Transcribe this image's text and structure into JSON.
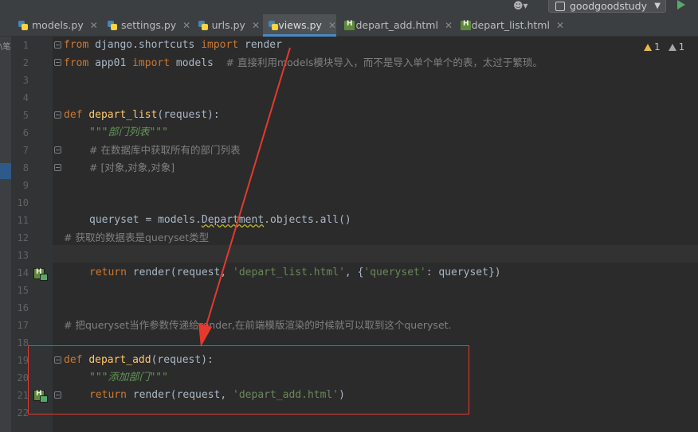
{
  "branch": "goodgoodstudy",
  "left_label": "\\笔",
  "tabs": [
    {
      "label": "models.py",
      "icon": "python-file-icon"
    },
    {
      "label": "settings.py",
      "icon": "python-file-icon"
    },
    {
      "label": "urls.py",
      "icon": "python-file-icon"
    },
    {
      "label": "views.py",
      "icon": "python-file-icon",
      "active": true
    },
    {
      "label": "depart_add.html",
      "icon": "html-file-icon"
    },
    {
      "label": "depart_list.html",
      "icon": "html-file-icon"
    }
  ],
  "inspections": {
    "warnings": "1",
    "weak_warnings": "1"
  },
  "line_numbers": [
    "1",
    "2",
    "3",
    "4",
    "5",
    "6",
    "7",
    "8",
    "9",
    "10",
    "11",
    "12",
    "13",
    "14",
    "15",
    "16",
    "17",
    "18",
    "19",
    "20",
    "21",
    "22"
  ],
  "code": {
    "l1": {
      "kw1": "from",
      "t1": " django.shortcuts ",
      "kw2": "import",
      "t2": " render"
    },
    "l2": {
      "kw1": "from",
      "t1": " app01 ",
      "kw2": "import",
      "t2": " models  ",
      "cm": "# 直接利用models模块导入，而不是导入单个单个的表，太过于繁琐。"
    },
    "l5": {
      "kw": "def",
      "fn": "depart_list",
      "t": "(request):"
    },
    "l6": {
      "doc": "\"\"\"部门列表\"\"\""
    },
    "l7": {
      "cm": "# 在数据库中获取所有的部门列表"
    },
    "l8": {
      "cm": "# [对象,对象,对象]"
    },
    "l11": {
      "t1": "queryset = models.",
      "u": "Department",
      "t2": ".objects.all()"
    },
    "l12": {
      "cm": "# 获取的数据表是queryset类型"
    },
    "l14": {
      "kw": "return",
      "t1": " render(request, ",
      "s1": "'depart_list.html'",
      "t2": ", {",
      "s2": "'queryset'",
      "t3": ": queryset})"
    },
    "l17": {
      "cm": "# 把queryset当作参数传递给render,在前端模版渲染的时候就可以取到这个queryset."
    },
    "l19": {
      "kw": "def",
      "fn": "depart_add",
      "t": "(request):"
    },
    "l20": {
      "doc": "\"\"\"添加部门\"\"\""
    },
    "l21": {
      "kw": "return",
      "t1": " render(request, ",
      "s1": "'depart_add.html'",
      "t2": ")"
    }
  },
  "colors": {
    "annotation": "#e5392e",
    "keyword": "#cc7832",
    "function": "#ffc66d",
    "string": "#6a8759",
    "comment": "#808080"
  }
}
